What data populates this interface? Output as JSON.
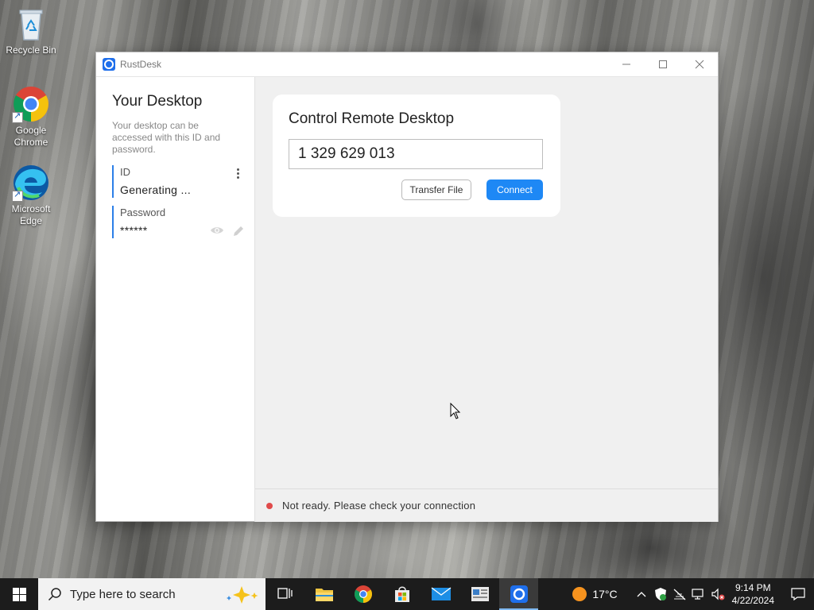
{
  "desktop": {
    "icons": [
      {
        "label": "Recycle Bin",
        "icon": "recycle-bin-icon"
      },
      {
        "label": "Google Chrome",
        "icon": "chrome-icon"
      },
      {
        "label": "Microsoft Edge",
        "icon": "edge-icon"
      }
    ]
  },
  "window": {
    "title": "RustDesk",
    "controls": {
      "minimize": "minimize-icon",
      "maximize": "maximize-icon",
      "close": "close-icon"
    }
  },
  "sidebar": {
    "title": "Your Desktop",
    "description": "Your desktop can be accessed with this ID and password.",
    "id_label": "ID",
    "id_value": "Generating ...",
    "password_label": "Password",
    "password_value": "******"
  },
  "remote": {
    "title": "Control Remote Desktop",
    "id_input_value": "1 329 629 013",
    "transfer_file_label": "Transfer File",
    "connect_label": "Connect"
  },
  "status": {
    "text": "Not ready. Please check your connection",
    "color": "#e04a4a"
  },
  "taskbar": {
    "search_placeholder": "Type here to search",
    "apps": [
      "task-view-icon",
      "file-explorer-icon",
      "chrome-icon",
      "store-icon",
      "mail-icon",
      "news-icon",
      "rustdesk-icon"
    ],
    "weather": "17°C",
    "time": "9:14 PM",
    "date": "4/22/2024"
  },
  "colors": {
    "accent": "#1e88f5",
    "field_border": "#2c7fe8"
  }
}
